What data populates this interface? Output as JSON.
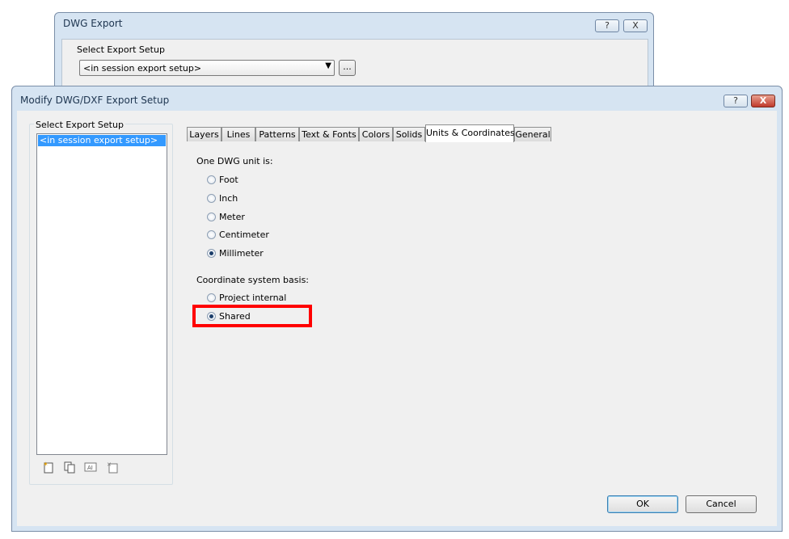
{
  "back_window": {
    "title": "DWG Export",
    "help_label": "?",
    "close_label": "X",
    "select_label": "Select Export Setup",
    "dropdown_value": "<in session export setup>",
    "browse_label": "..."
  },
  "dialog": {
    "title": "Modify DWG/DXF Export Setup",
    "help_label": "?",
    "close_label": "X",
    "left_group_label": "Select Export Setup",
    "setups": [
      "<in session export setup>"
    ],
    "tabs": [
      {
        "label": "Layers"
      },
      {
        "label": "Lines"
      },
      {
        "label": "Patterns"
      },
      {
        "label": "Text & Fonts"
      },
      {
        "label": "Colors"
      },
      {
        "label": "Solids"
      },
      {
        "label": "Units & Coordinates"
      },
      {
        "label": "General"
      }
    ],
    "active_tab": "Units & Coordinates",
    "units": {
      "heading": "One DWG unit is:",
      "options": [
        "Foot",
        "Inch",
        "Meter",
        "Centimeter",
        "Millimeter"
      ],
      "selected": "Millimeter"
    },
    "coords": {
      "heading": "Coordinate system basis:",
      "options": [
        "Project internal",
        "Shared"
      ],
      "selected": "Shared"
    },
    "ok_label": "OK",
    "cancel_label": "Cancel",
    "tool_icons": [
      "new-setup-icon",
      "duplicate-setup-icon",
      "rename-setup-icon",
      "delete-setup-icon"
    ],
    "highlight_color": "#ff0000"
  }
}
